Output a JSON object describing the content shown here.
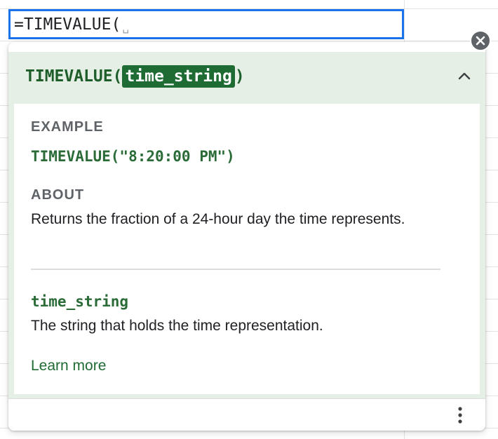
{
  "formula_editor": {
    "value": "=TIMEVALUE(",
    "cursor_glyph": "␣"
  },
  "help_card": {
    "signature": {
      "function_name": "TIMEVALUE",
      "open_paren": "(",
      "param": "time_string",
      "close_paren": ")"
    },
    "example": {
      "label": "EXAMPLE",
      "code": "TIMEVALUE(\"8:20:00 PM\")"
    },
    "about": {
      "label": "ABOUT",
      "text": "Returns the fraction of a 24-hour day the time represents."
    },
    "parameter": {
      "name": "time_string",
      "description": "The string that holds the time representation."
    },
    "learn_more_label": "Learn more"
  },
  "icons": {
    "close": "close-icon",
    "collapse": "chevron-up-icon",
    "more": "more-vert-icon"
  },
  "colors": {
    "accent_blue": "#1a73e8",
    "green_text": "#1e5e2a",
    "param_highlight": "#1e6b34",
    "header_bg": "#e6efe5"
  }
}
